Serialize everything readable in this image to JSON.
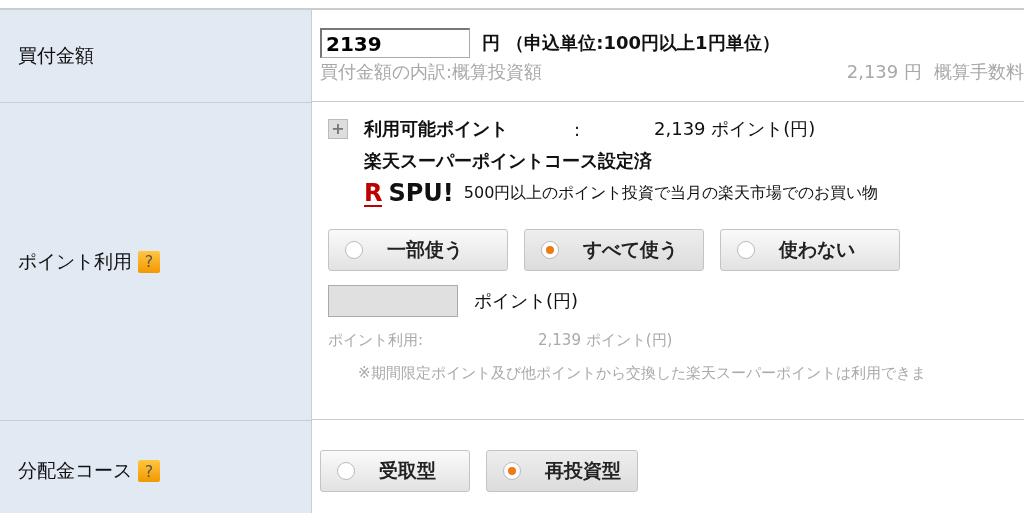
{
  "purchase_amount": {
    "label": "買付金額",
    "value": "2139",
    "unit_note": "円 （申込単位:100円以上1円単位）",
    "breakdown_label": "買付金額の内訳:概算投資額",
    "breakdown_value": "2,139 円",
    "fee_label": "概算手数料"
  },
  "point_use": {
    "label": "ポイント利用",
    "help": "?",
    "expand": "+",
    "available_label": "利用可能ポイント",
    "colon": ":",
    "available_value": "2,139 ポイント(円)",
    "course": "楽天スーパーポイントコース設定済",
    "logo_mark": "R",
    "logo_text": "SPU!",
    "spu_text": "500円以上のポイント投資で当月の楽天市場でのお買い物",
    "options": [
      {
        "label": "一部使う",
        "selected": false
      },
      {
        "label": "すべて使う",
        "selected": true
      },
      {
        "label": "使わない",
        "selected": false
      }
    ],
    "points_field": {
      "disabled": true
    },
    "points_unit": "ポイント(円)",
    "usage_label": "ポイント利用:",
    "usage_value": "2,139 ポイント(円)",
    "note": "※期間限定ポイント及び他ポイントから交換した楽天スーパーポイントは利用できま"
  },
  "distribution": {
    "label": "分配金コース",
    "help": "?",
    "options": [
      {
        "label": "受取型",
        "selected": false
      },
      {
        "label": "再投資型",
        "selected": true
      }
    ]
  }
}
